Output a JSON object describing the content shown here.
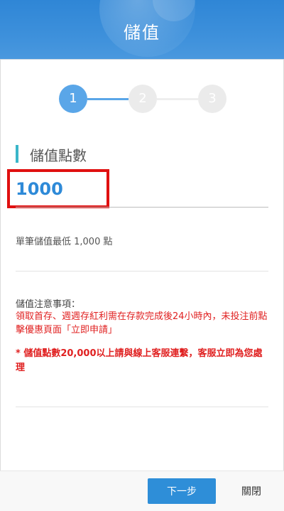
{
  "header": {
    "title": "儲值"
  },
  "stepper": {
    "steps": [
      "1",
      "2",
      "3"
    ],
    "active_step": 1
  },
  "amount_section": {
    "title": "儲值點數",
    "value": "1000",
    "min_note": "單筆儲值最低 1,000 點"
  },
  "notes": {
    "title": "儲值注意事項：",
    "red_text": "領取首存、週週存紅利需在存款完成後24小時內，未投注前點擊優惠頁面「立即申請」",
    "bold_text": "* 儲值點數20,000以上請與線上客服連繫，客服立即為您處理"
  },
  "footer": {
    "next_label": "下一步",
    "close_label": "關閉"
  },
  "colors": {
    "accent": "#2e8ed8",
    "step_active": "#5aa6e8",
    "warning": "#e02020",
    "highlight_box": "#e01010",
    "section_bar": "#3ab6c9"
  }
}
